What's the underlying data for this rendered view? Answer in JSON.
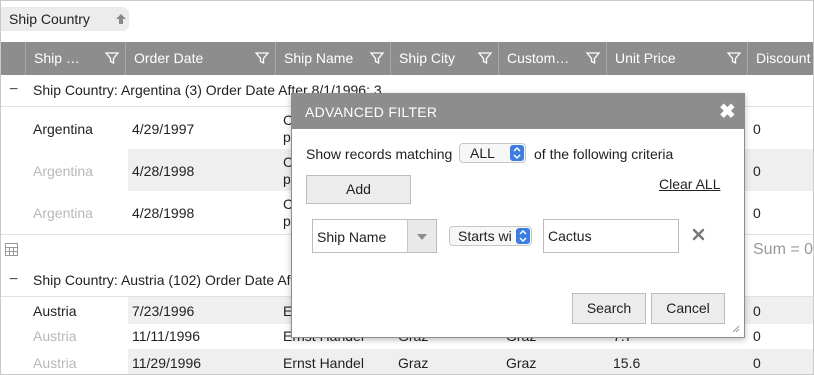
{
  "group_panel": {
    "chip_label": "Ship Country",
    "chip_icon": "arrow-up-icon"
  },
  "columns": [
    {
      "label": "Ship …"
    },
    {
      "label": "Order Date"
    },
    {
      "label": "Ship Name"
    },
    {
      "label": "Ship City"
    },
    {
      "label": "Custom…"
    },
    {
      "label": "Unit Price"
    },
    {
      "label": "Discount"
    }
  ],
  "groups": [
    {
      "label": "Ship Country: Argentina (3) Order Date After 8/1/1996: 3",
      "rows": [
        {
          "country": "Argentina",
          "date": "4/29/1997",
          "ship_name": "C",
          "ship_name_2": "p",
          "discount": "0"
        },
        {
          "country": "Argentina",
          "date": "4/28/1998",
          "ship_name": "C",
          "ship_name_2": "p",
          "discount": "0"
        },
        {
          "country": "Argentina",
          "date": "4/28/1998",
          "ship_name": "C",
          "ship_name_2": "p",
          "discount": "0"
        }
      ],
      "summary": "Sum = 0"
    },
    {
      "label": "Ship Country: Austria (102) Order Date Af",
      "rows": [
        {
          "country": "Austria",
          "date": "7/23/1996",
          "ship_name": "E",
          "city": "",
          "customer": "",
          "price": "",
          "discount": "0"
        },
        {
          "country": "Austria",
          "date": "11/11/1996",
          "ship_name": "Ernst Handel",
          "city": "Graz",
          "customer": "Graz",
          "price": "7.7",
          "discount": "0"
        },
        {
          "country": "Austria",
          "date": "11/29/1996",
          "ship_name": "Ernst Handel",
          "city": "Graz",
          "customer": "Graz",
          "price": "15.6",
          "discount": "0"
        }
      ]
    }
  ],
  "dialog": {
    "title": "ADVANCED FILTER",
    "close_icon": "close-icon",
    "match_prefix": "Show records matching",
    "match_value": "ALL",
    "match_suffix": "of the following criteria",
    "add_label": "Add",
    "clear_label": "Clear ALL",
    "criterion": {
      "field": "Ship Name",
      "operator": "Starts wi",
      "value": "Cactus"
    },
    "search_label": "Search",
    "cancel_label": "Cancel"
  },
  "colors": {
    "header_bg": "#8d8d8d",
    "alt_row": "#efefef",
    "accent": "#3b7de0"
  }
}
